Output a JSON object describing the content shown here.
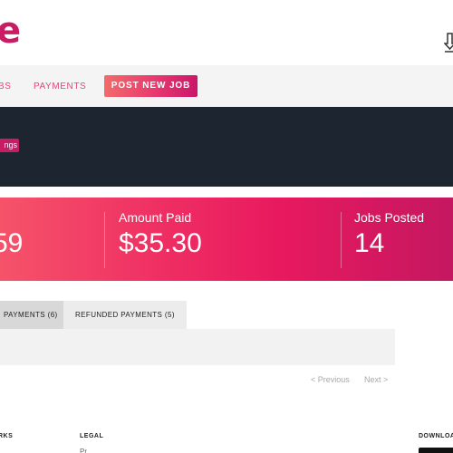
{
  "header": {
    "logo_fragment": "e",
    "download_icon": "download-icon"
  },
  "nav": {
    "jobs_label_fragment": "BS",
    "payments_label": "PAYMENTS",
    "post_job_label": "POST NEW JOB"
  },
  "banner": {
    "tag_fragment": "ngs"
  },
  "stats": [
    {
      "label": "",
      "value": "59"
    },
    {
      "label": "Amount Paid",
      "value": "$35.30"
    },
    {
      "label": "Jobs Posted",
      "value": "14"
    }
  ],
  "tabs": [
    {
      "label": "PAYMENTS (6)",
      "active": true
    },
    {
      "label": "REFUNDED PAYMENTS (5)",
      "active": false
    }
  ],
  "pagination": {
    "previous": "< Previous",
    "next": "Next >"
  },
  "footer": {
    "works_heading_fragment": "RKS",
    "legal_heading": "LEGAL",
    "legal_link_fragment": "Pr",
    "download_heading": "DOWNLOA"
  },
  "colors": {
    "brand": "#c81c64",
    "nav_link": "#e8457a",
    "banner_bg": "#1d2630",
    "stats_gradient_start": "#f5536a",
    "stats_gradient_end": "#c41860"
  }
}
